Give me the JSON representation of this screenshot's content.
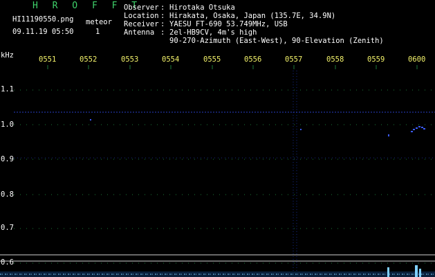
{
  "app": {
    "title": "H R O F F T",
    "filename": "HI11190550.png",
    "datetime": "09.11.19 05:50",
    "meteor_label": "meteor",
    "meteor_count": "1"
  },
  "station": {
    "observer_label": "Observer",
    "observer": "Hirotaka Otsuka",
    "location_label": "Location",
    "location": "Hirakata, Osaka, Japan (135.7E, 34.9N)",
    "receiver_label": "Receiver",
    "receiver": "YAESU FT-690 53.749MHz, USB",
    "antenna_label": "Antenna",
    "antenna_line1": "2el-HB9CV, 4m's high",
    "antenna_line2": "90-270-Azimuth (East-West), 90-Elevation (Zenith)"
  },
  "spectrogram": {
    "y_unit": "kHz",
    "x_ticks": [
      "0551",
      "0552",
      "0553",
      "0554",
      "0555",
      "0556",
      "0557",
      "0558",
      "0559",
      "0600"
    ],
    "y_ticks": [
      "1.1",
      "1.0",
      "0.9",
      "0.8",
      "0.7",
      "0.6"
    ],
    "colors": {
      "background": "#000000",
      "grid": "#1c7a3a",
      "signal": "#3b5bff",
      "baseline_trace": "#7fd0ff",
      "tick_label": "#f4f36b",
      "header_title": "#3fd36b"
    }
  }
}
